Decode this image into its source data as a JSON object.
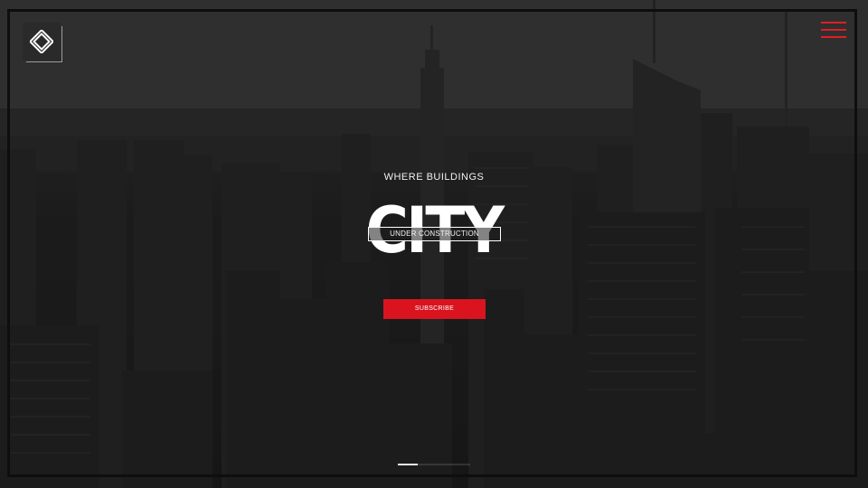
{
  "header": {
    "logo": {
      "icon": "diamond-logo-icon"
    },
    "menu": {
      "icon": "hamburger-menu-icon",
      "color": "#e01e24"
    }
  },
  "hero": {
    "kicker": "WHERE BUILDINGS",
    "title": "CITY",
    "badge": "UNDER CONSTRUCTION",
    "cta": "SUBSCRIBE"
  },
  "slider": {
    "slides": 2,
    "active_index": 0
  },
  "colors": {
    "accent": "#d9141f",
    "text": "#ffffff",
    "background": "#1b1b1b"
  }
}
